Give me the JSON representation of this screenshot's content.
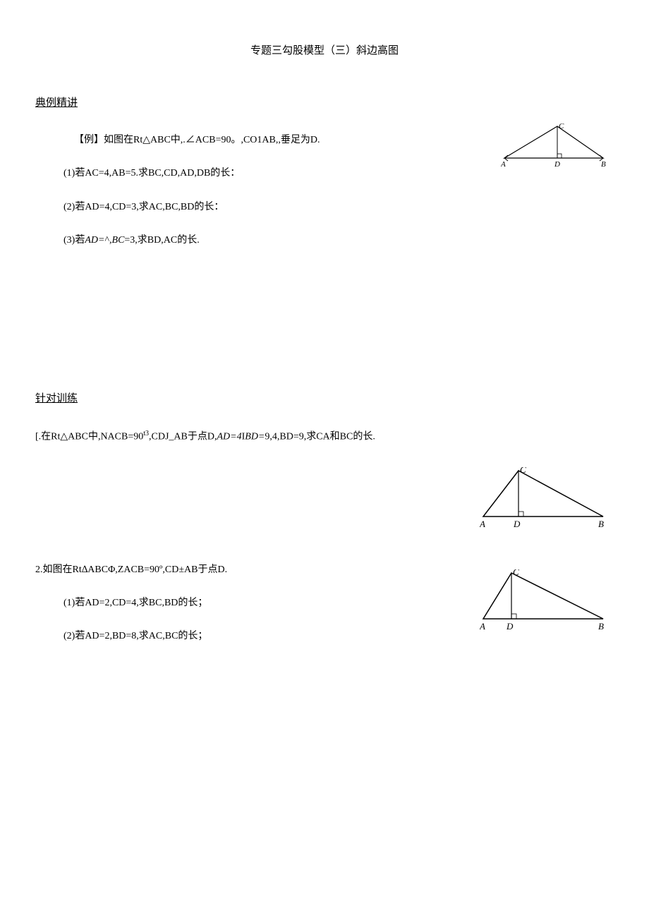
{
  "title": "专题三勾股模型（三）斜边高图",
  "section1": {
    "header": "典例精讲",
    "example_intro": "【例】如图在Rt△ABC中,.∠ACB=90。,CO1AB,,垂足为D.",
    "q1": "(1)若AC=4,AB=5.求BC,CD,AD,DB的长：",
    "q2": "(2)若AD=4,CD=3,求AC,BC,BD的长：",
    "q3_prefix": "(3)若",
    "q3_var1": "AD=",
    "q3_mid1": "^,",
    "q3_var2": "BC",
    "q3_mid2": "=3,求BD,AC的长.",
    "fig_labels": {
      "A": "A",
      "B": "B",
      "C": "C",
      "D": "D"
    }
  },
  "section2": {
    "header": "针对训练",
    "p1_prefix": "[.在Rt△ABC中,NACB=90",
    "p1_sup": "t3",
    "p1_mid1": ",CDJ_AB于点D,",
    "p1_var1": "AD=4",
    "p1_sub": "I",
    "p1_var2": "BD=",
    "p1_mid2": "9,4,BD=9,求CA和BC的长.",
    "p1_fig_labels": {
      "A": "A",
      "B": "B",
      "C": "C",
      "D": "D"
    },
    "p2_intro": "2.如图在Rt∆ABCΦ,ZACB=90º,CD±AB于点D.",
    "p2_q1": "(1)若AD=2,CD=4,求BC,BD的长；",
    "p2_q2": "(2)若AD=2,BD=8,求AC,BC的长；",
    "p2_fig_labels": {
      "A": "A",
      "B": "B",
      "C": "C",
      "D": "D"
    }
  }
}
